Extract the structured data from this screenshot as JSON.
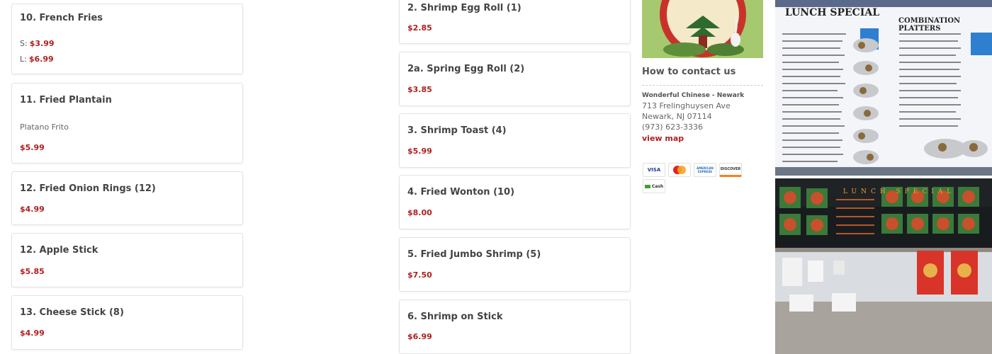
{
  "left_menu": [
    {
      "title": "10. French Fries",
      "sizes": [
        {
          "label": "S:",
          "price": "$3.99"
        },
        {
          "label": "L:",
          "price": "$6.99"
        }
      ]
    },
    {
      "title": "11. Fried Plantain",
      "desc": "Platano Frito",
      "price": "$5.99"
    },
    {
      "title": "12. Fried Onion Rings (12)",
      "price": "$4.99"
    },
    {
      "title": "12. Apple Stick",
      "price": "$5.85"
    },
    {
      "title": "13. Cheese Stick (8)",
      "price": "$4.99"
    }
  ],
  "middle_menu": [
    {
      "title": "2. Shrimp Egg Roll (1)",
      "price": "$2.85"
    },
    {
      "title": "2a. Spring Egg Roll (2)",
      "price": "$3.85"
    },
    {
      "title": "3. Shrimp Toast (4)",
      "price": "$5.99"
    },
    {
      "title": "4. Fried Wonton (10)",
      "price": "$8.00"
    },
    {
      "title": "5. Fried Jumbo Shrimp (5)",
      "price": "$7.50"
    },
    {
      "title": "6. Shrimp on Stick",
      "price": "$6.99"
    }
  ],
  "contact": {
    "heading": "How to contact us",
    "business": "Wonderful Chinese - Newark",
    "street": "713 Frelinghuysen Ave",
    "city": "Newark, NJ 07114",
    "phone": "(973) 623-3336",
    "map_link": "view map"
  },
  "payments": [
    "VISA",
    "MC",
    "AMERICAN EXPRESS",
    "DISCOVER",
    "Cash"
  ],
  "photos": {
    "menu_board_left_title": "LUNCH SPECIAL",
    "menu_board_right_title": "COMBINATION PLATTERS",
    "storefront_sign": "LUNCH SPECIAL"
  },
  "colors": {
    "price": "#b01f1f",
    "text": "#444444",
    "border": "#e3e3e3"
  }
}
